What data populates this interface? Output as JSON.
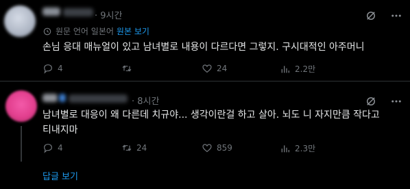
{
  "tweets": [
    {
      "time": "· 9시간",
      "translate_note": "원문 언어 일본어",
      "show_original": "원본 보기",
      "text": "손님 응대 매뉴얼이 있고 남녀별로 내용이 다르다면 그렇지. 구시대적인 아주머니",
      "stats": {
        "replies": "4",
        "retweets": "",
        "likes": "24",
        "views": "2.2만"
      }
    },
    {
      "time": "· 8시간",
      "text": "남녀별로 대응이 왜 다른데 치규야... 생각이란걸 하고 살아. 뇌도 니 자지만큼 작다고\n티내지마",
      "stats": {
        "replies": "4",
        "retweets": "24",
        "likes": "859",
        "views": "2.3만"
      }
    }
  ],
  "show_replies": "답글 보기",
  "colors": {
    "background": "#000000",
    "text": "#e7e9ea",
    "secondary": "#71767b",
    "accent": "#1d9bf0",
    "divider": "#2f3336"
  },
  "icons": [
    "grok-icon",
    "more-icon",
    "translate-icon",
    "reply-icon",
    "retweet-icon",
    "like-icon",
    "views-icon"
  ]
}
